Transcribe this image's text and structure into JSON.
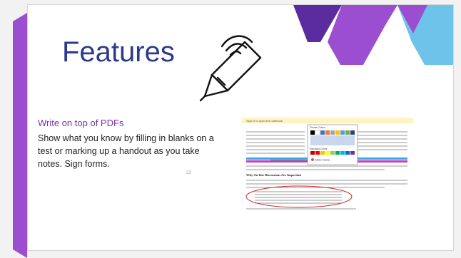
{
  "slide": {
    "title": "Features",
    "subheading": "Write on top of PDFs",
    "body_text": "Show what you know by filling in blanks on a test or marking up a handout as you take notes. Sign forms.",
    "page_number": "22"
  },
  "embedded_doc": {
    "notice": "Sign in to sync this notebook",
    "palette_title": "Theme Colors",
    "standard_colors_label": "Standard Colors",
    "more_colors_label": "More Colors...",
    "section_heading": "Why On-line Discussions Are Important"
  },
  "colors": {
    "title": "#2b3a8c",
    "accent_purple": "#9b4fd0",
    "accent_blue": "#57b8e8",
    "subheading": "#7a2fb3"
  },
  "icons": {
    "pen": "digital-pen-icon"
  }
}
